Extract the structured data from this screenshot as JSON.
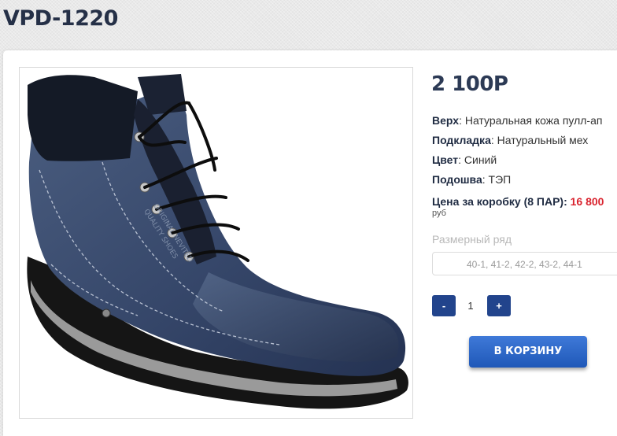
{
  "product": {
    "title": "VPD-1220",
    "price": "2 100Р",
    "image_alt": "blue leather boot"
  },
  "specs": [
    {
      "label": "Верх",
      "value": ": Натуральная кожа пулл-ап"
    },
    {
      "label": "Подкладка",
      "value": ": Натуральный мех"
    },
    {
      "label": "Цвет",
      "value": ": Синий"
    },
    {
      "label": "Подошва",
      "value": ": ТЭП"
    }
  ],
  "box_price": {
    "label": "Цена за коробку (8 ПАР): ",
    "value": "16 800",
    "currency": "руб"
  },
  "sizes": {
    "label": "Размерный ряд",
    "selected": "40-1, 41-2, 42-2, 43-2, 44-1"
  },
  "quantity": {
    "minus": "-",
    "value": "1",
    "plus": "+"
  },
  "cart": {
    "label": "В КОРЗИНУ"
  },
  "colors": {
    "title": "#253047",
    "accent": "#22448c",
    "price_red": "#d9232e",
    "boot_leather": "#3b4c6b"
  }
}
